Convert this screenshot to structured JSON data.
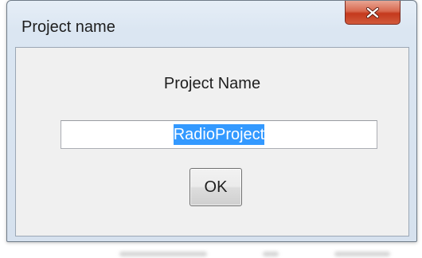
{
  "window": {
    "title": "Project name",
    "close_icon": "close-icon"
  },
  "dialog": {
    "heading": "Project Name",
    "name_input_value": "RadioProject",
    "ok_label": "OK"
  },
  "colors": {
    "selection": "#3399ff",
    "close_button": "#c4391d",
    "frame": "#dbe6f2"
  }
}
